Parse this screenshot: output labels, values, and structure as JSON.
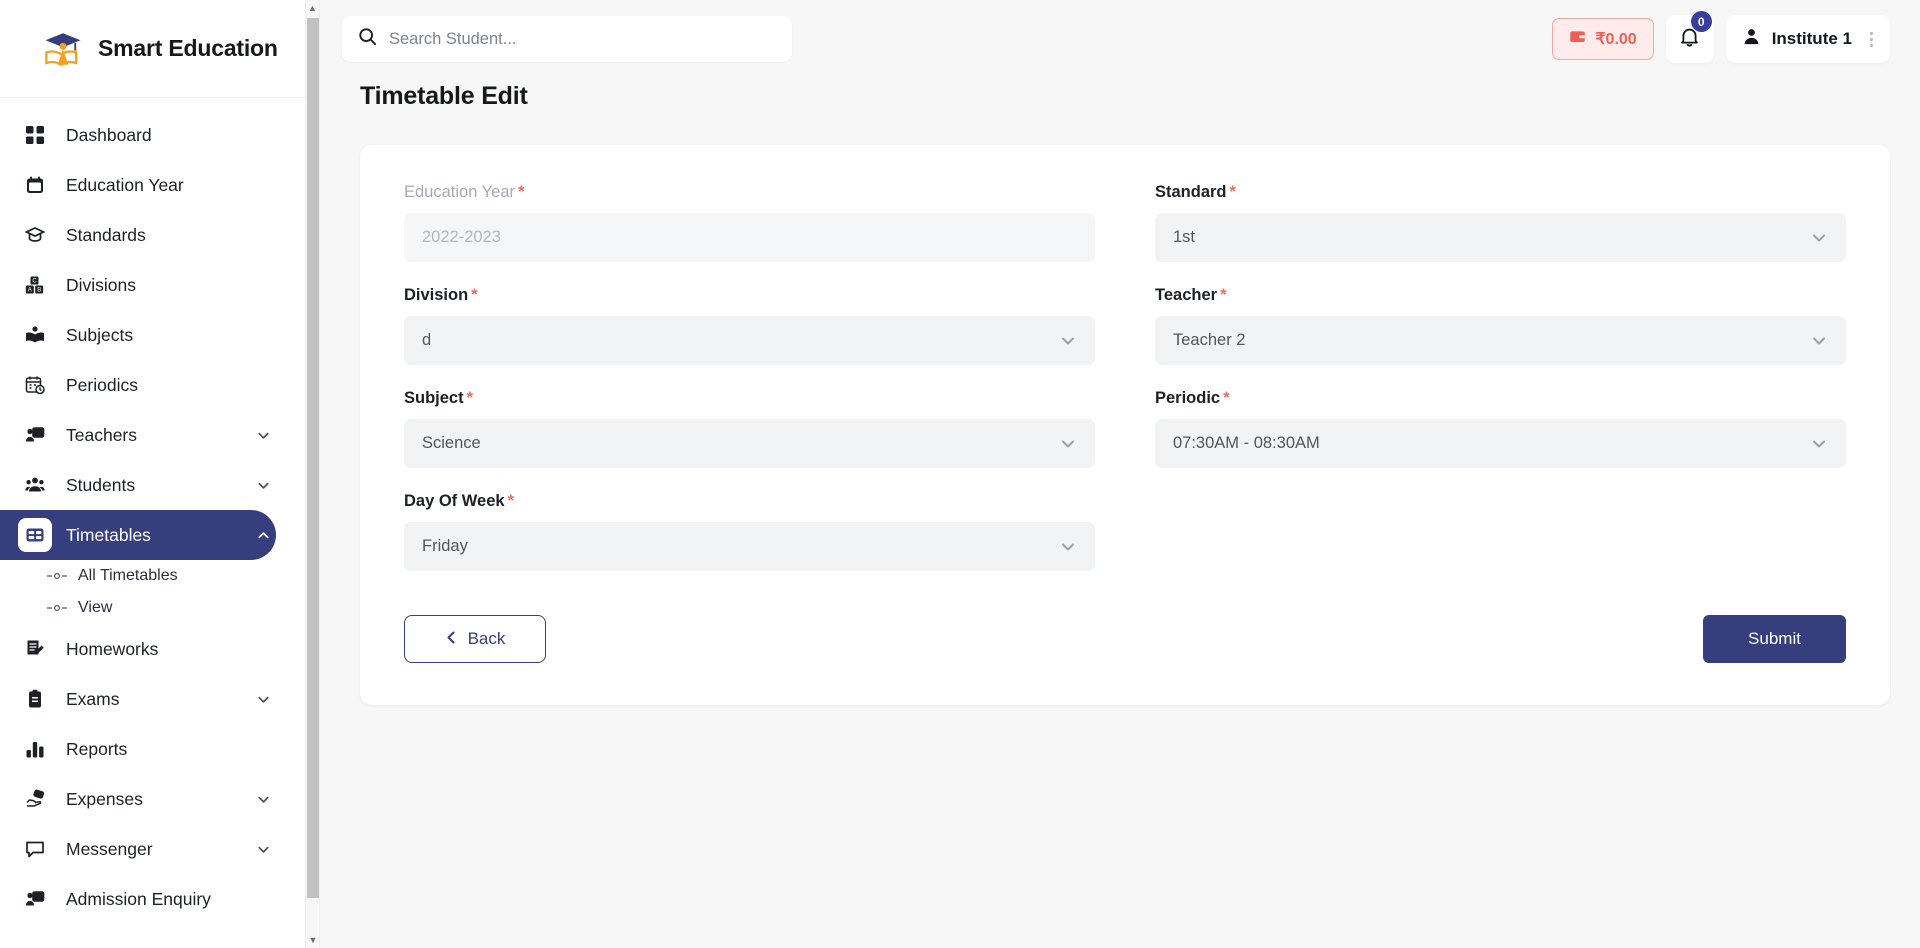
{
  "brand": {
    "name": "Smart Education",
    "logo_icon": "graduation-cap-logo"
  },
  "sidebar": {
    "items": [
      {
        "label": "Dashboard",
        "icon": "grid-icon",
        "expandable": false,
        "active": false
      },
      {
        "label": "Education Year",
        "icon": "calendar-icon",
        "expandable": false,
        "active": false
      },
      {
        "label": "Standards",
        "icon": "graduation-cap-icon",
        "expandable": false,
        "active": false
      },
      {
        "label": "Divisions",
        "icon": "blocks-icon",
        "expandable": false,
        "active": false
      },
      {
        "label": "Subjects",
        "icon": "book-icon",
        "expandable": false,
        "active": false
      },
      {
        "label": "Periodics",
        "icon": "calendar-clock-icon",
        "expandable": false,
        "active": false
      },
      {
        "label": "Teachers",
        "icon": "teacher-board-icon",
        "expandable": true,
        "active": false
      },
      {
        "label": "Students",
        "icon": "users-icon",
        "expandable": true,
        "active": false
      },
      {
        "label": "Timetables",
        "icon": "table-icon",
        "expandable": true,
        "active": true
      },
      {
        "label": "Homeworks",
        "icon": "note-edit-icon",
        "expandable": false,
        "active": false
      },
      {
        "label": "Exams",
        "icon": "clipboard-icon",
        "expandable": true,
        "active": false
      },
      {
        "label": "Reports",
        "icon": "bar-chart-icon",
        "expandable": false,
        "active": false
      },
      {
        "label": "Expenses",
        "icon": "hand-money-icon",
        "expandable": true,
        "active": false
      },
      {
        "label": "Messenger",
        "icon": "chat-bubble-icon",
        "expandable": true,
        "active": false
      },
      {
        "label": "Admission Enquiry",
        "icon": "teacher-board-icon",
        "expandable": false,
        "active": false
      }
    ],
    "timetables_subitems": [
      {
        "label": "All Timetables"
      },
      {
        "label": "View"
      }
    ],
    "active_color": "#373e7e"
  },
  "topbar": {
    "search": {
      "placeholder": "Search Student...",
      "value": "",
      "icon": "search-icon"
    },
    "wallet": {
      "amount": "₹0.00",
      "icon": "wallet-icon",
      "color": "#ef5f52"
    },
    "notifications": {
      "count": "0",
      "icon": "bell-icon",
      "badge_color": "#373e9e"
    },
    "user": {
      "name": "Institute 1",
      "icon": "person-icon",
      "menu_icon": "kebab-menu-icon"
    }
  },
  "page": {
    "title": "Timetable Edit"
  },
  "form": {
    "fields": [
      {
        "label": "Education Year",
        "required": true,
        "value": "2022-2023",
        "type": "text",
        "disabled": true,
        "column": "left"
      },
      {
        "label": "Standard",
        "required": true,
        "value": "1st",
        "type": "select",
        "disabled": false,
        "column": "right"
      },
      {
        "label": "Division",
        "required": true,
        "value": "d",
        "type": "select",
        "disabled": false,
        "column": "left"
      },
      {
        "label": "Teacher",
        "required": true,
        "value": "Teacher 2",
        "type": "select",
        "disabled": false,
        "column": "right"
      },
      {
        "label": "Subject",
        "required": true,
        "value": "Science",
        "type": "select",
        "disabled": false,
        "column": "left"
      },
      {
        "label": "Periodic",
        "required": true,
        "value": "07:30AM - 08:30AM",
        "type": "select",
        "disabled": false,
        "column": "right"
      },
      {
        "label": "Day Of Week",
        "required": true,
        "value": "Friday",
        "type": "select",
        "disabled": false,
        "column": "left"
      }
    ],
    "required_marker": "*",
    "back_label": "Back",
    "submit_label": "Submit"
  }
}
